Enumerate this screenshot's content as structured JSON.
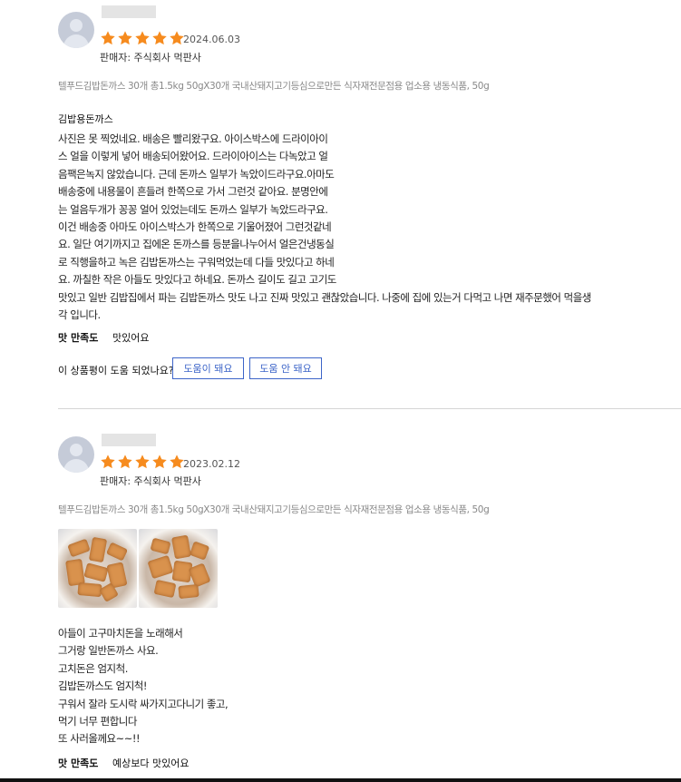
{
  "reviews": [
    {
      "rating": 5,
      "date": "2024.06.03",
      "seller": "판매자: 주식회사 먹판사",
      "product": "텔푸드김밥돈까스 30개 총1.5kg 50gX30개 국내산돼지고기등심으로만든 식자재전문점용 업소용 냉동식품, 50g",
      "option_title": "김밥용돈까스",
      "body_lines": [
        "사진은 못 찍었네요. 배송은 빨리왔구요. 아이스박스에 드라이아이",
        "스 얼을 이렇게 넣어 배송되어왔어요. 드라이아이스는 다녹았고 얼",
        "음팩은녹지 않았습니다. 근데 돈까스 일부가 녹았이드라구요.아마도",
        "배송중에 내용물이 흔들려 한쪽으로 가서 그런것 같아요. 분명안에",
        "는 얼음두개가 꽁꽁 얼어 있었는데도 돈까스 일부가 녹았드라구요.",
        "이건 배송중 아마도 아이스박스가 한쪽으로 기울어졌어 그런것같네",
        "요. 일단 여기까지고 집에온 돈까스를 등분을나누어서 얼은건냉동실",
        "로 직행을하고 녹은 김밥돈까스는 구워먹었는데 다들 맛있다고 하네",
        "요. 까칠한 작은 아들도 맛있다고 하네요. 돈까스 길이도 길고 고기도",
        "맛있고 일반 김밥집에서 파는 김밥돈까스 맛도 나고 진짜 맛있고 괜찮았습니다. 나중에 집에 있는거 다먹고 나면 재주문했어 먹을생",
        "각 입니다."
      ],
      "satisfaction_label": "맛 만족도",
      "satisfaction_value": "맛있어요",
      "helpful_question": "이 상품평이 도움 되었나요?",
      "helpful_yes": "도움이 돼요",
      "helpful_no": "도움 안 돼요"
    },
    {
      "rating": 5,
      "date": "2023.02.12",
      "seller": "판매자: 주식회사 먹판사",
      "product": "텔푸드김밥돈까스 30개 총1.5kg 50gX30개 국내산돼지고기등심으로만든 식자재전문점용 업소용 냉동식품, 50g",
      "body_lines": [
        "아들이 고구마치돈을 노래해서",
        "그거랑 일반돈까스 사요.",
        "고치돈은 엄지척.",
        "김밥돈까스도 엄지척!",
        "구워서 잘라 도시락 싸가지고다니기 좋고,",
        "먹기 너무 편합니다",
        "또 사러올께요~~!!"
      ],
      "satisfaction_label": "맛 만족도",
      "satisfaction_value": "예상보다 맛있어요"
    }
  ],
  "colors": {
    "star": "#f68b1e",
    "accent_blue": "#3d65c8",
    "avatar": "#c5cbd8"
  },
  "icons": {
    "star": "star-icon",
    "avatar": "user-avatar-icon"
  }
}
